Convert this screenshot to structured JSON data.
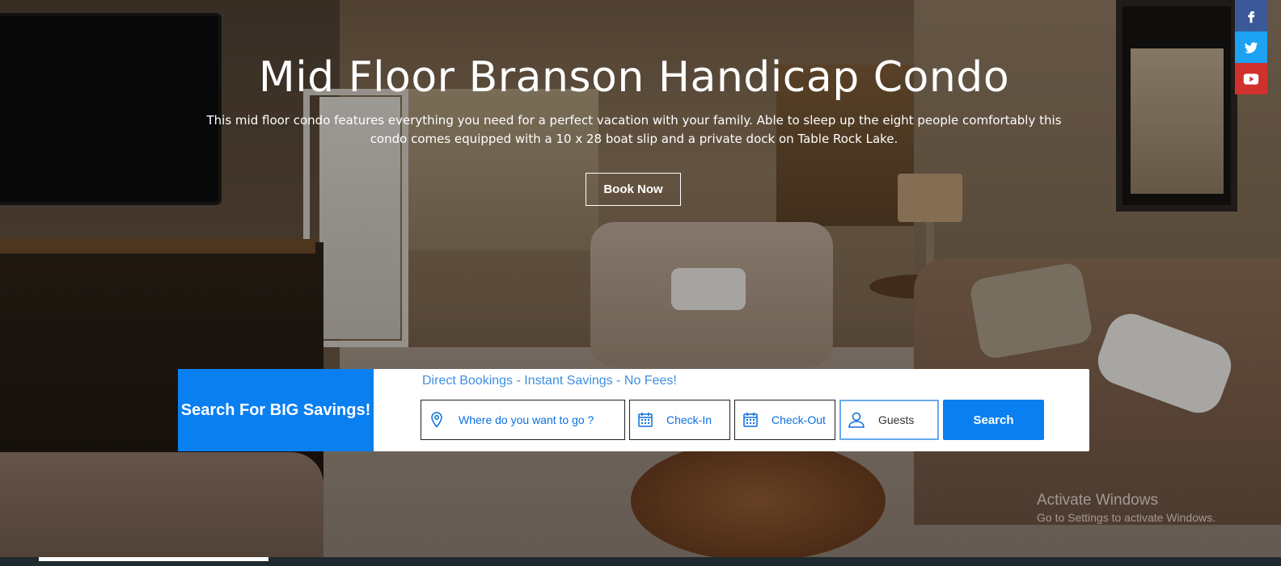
{
  "hero": {
    "title": "Mid Floor Branson Handicap Condo",
    "description": "This mid floor condo features everything you need for a perfect vacation with your family. Able to sleep up the eight people comfortably this condo comes equipped with a 10 x 28 boat slip and a private dock on Table Rock Lake.",
    "book_button": "Book Now"
  },
  "social": [
    {
      "name": "facebook-icon",
      "color": "#3b5998"
    },
    {
      "name": "twitter-icon",
      "color": "#1da1f2"
    },
    {
      "name": "youtube-icon",
      "color": "#d0312d"
    }
  ],
  "search": {
    "label": "Search For BIG Savings!",
    "tagline": "Direct Bookings - Instant Savings - No Fees!",
    "where_placeholder": "Where do you want to go ?",
    "checkin_label": "Check-In",
    "checkout_label": "Check-Out",
    "guests_label": "Guests",
    "search_button": "Search",
    "accent_color": "#0a7ff0"
  },
  "watermark": {
    "line1": "Activate Windows",
    "line2": "Go to Settings to activate Windows."
  }
}
